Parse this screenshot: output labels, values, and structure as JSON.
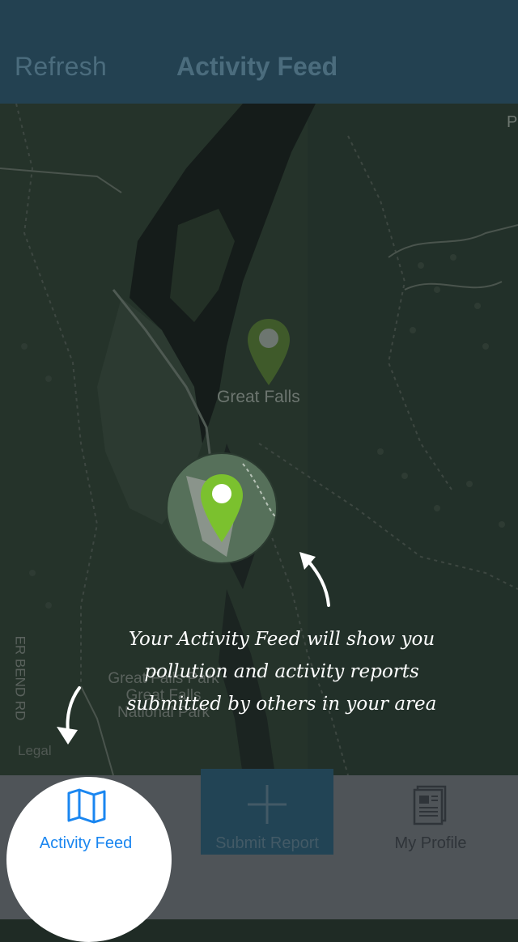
{
  "navbar": {
    "refresh_label": "Refresh",
    "title": "Activity Feed"
  },
  "map": {
    "place_label": "Great Falls",
    "park_label_line1": "Great Falls Park",
    "park_label_line2": "Great Falls",
    "park_label_line3": "National Park",
    "road_label": "ER BEND RD",
    "legal_label": "Legal",
    "corner_label": "P",
    "colors": {
      "pin_primary": "#7bc12e",
      "pin_dim": "#3f5a2a",
      "overlay": "#26352c"
    }
  },
  "onboarding": {
    "hint_text": "Your Activity Feed will show you pollution and activity reports submitted by others in your area"
  },
  "tabbar": {
    "tabs": [
      {
        "label": "Activity Feed",
        "icon": "map-icon",
        "selected": true
      },
      {
        "label": "Submit Report",
        "icon": "plus-icon",
        "selected": false
      },
      {
        "label": "My Profile",
        "icon": "document-icon",
        "selected": false
      }
    ]
  }
}
